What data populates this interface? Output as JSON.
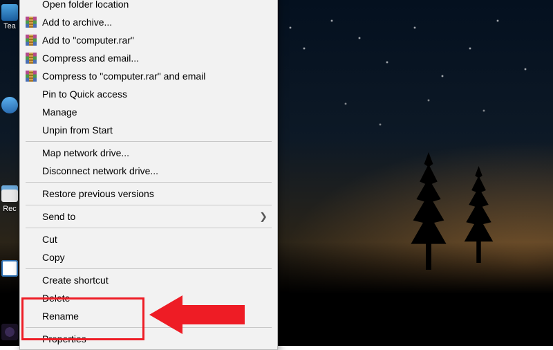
{
  "desktop": {
    "icons": {
      "teamviewer": "Tea",
      "recycle": "Rec"
    }
  },
  "menu": {
    "open_folder": "Open folder location",
    "add_archive": "Add to archive...",
    "add_to_rar": "Add to \"computer.rar\"",
    "compress_email": "Compress and email...",
    "compress_rar_email": "Compress to \"computer.rar\" and email",
    "pin_quick": "Pin to Quick access",
    "manage": "Manage",
    "unpin_start": "Unpin from Start",
    "map_drive": "Map network drive...",
    "disconnect_drive": "Disconnect network drive...",
    "restore_prev": "Restore previous versions",
    "send_to": "Send to",
    "cut": "Cut",
    "copy": "Copy",
    "create_shortcut": "Create shortcut",
    "delete": "Delete",
    "rename": "Rename",
    "properties": "Properties"
  },
  "colors": {
    "highlight": "#ee1c25"
  }
}
